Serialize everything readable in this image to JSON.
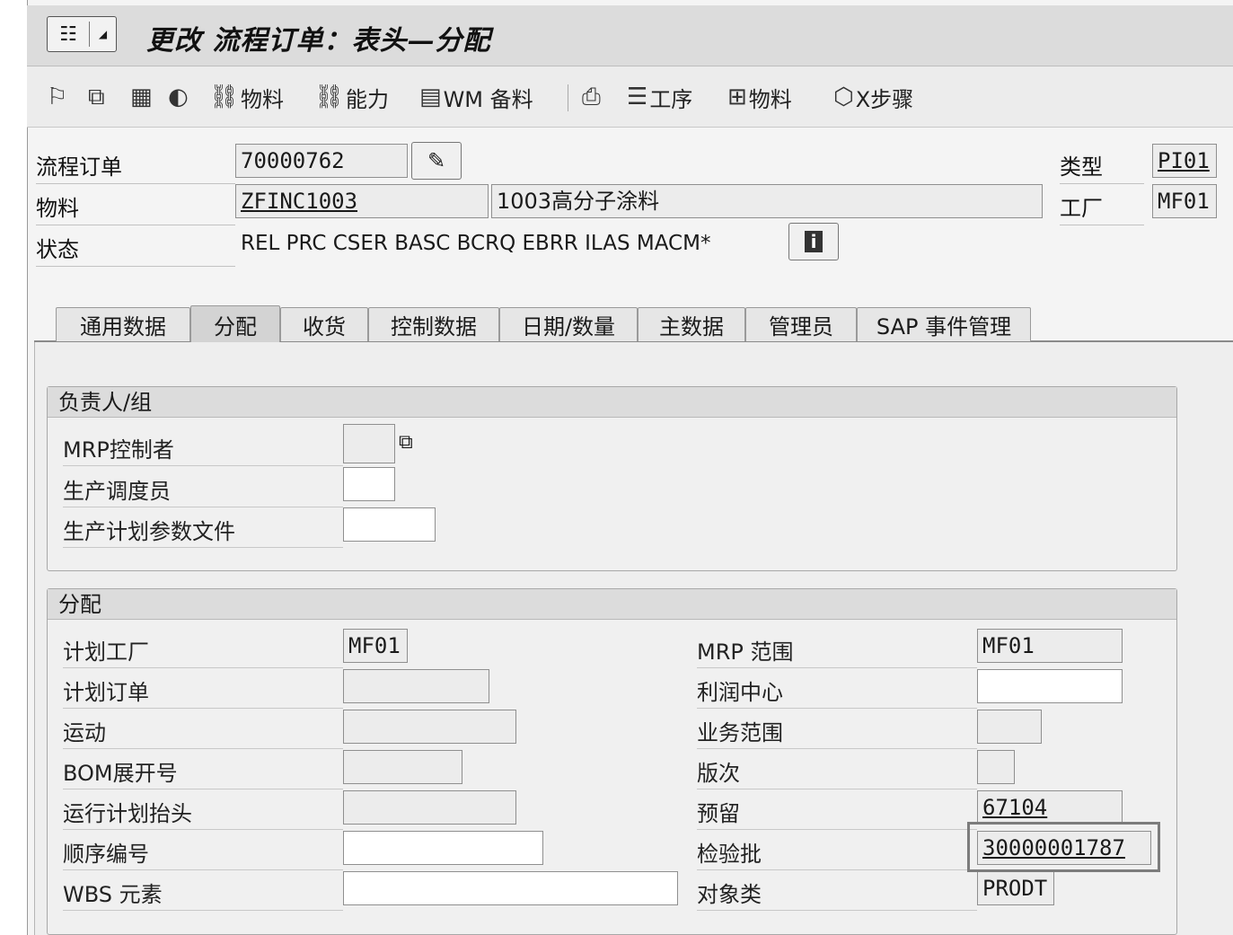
{
  "title": "更改 流程订单：表头—分配",
  "title_menu": {
    "icon": "sap-menu-icon",
    "dropdown": "chevron-down-icon"
  },
  "toolbar": [
    {
      "icon": "flag-icon",
      "label": ""
    },
    {
      "icon": "copy-icon",
      "label": ""
    },
    {
      "icon": "calculator-icon",
      "label": ""
    },
    {
      "icon": "globe-icon",
      "label": ""
    },
    {
      "icon": "hierarchy-icon",
      "label": "物料"
    },
    {
      "icon": "hierarchy-icon",
      "label": "能力"
    },
    {
      "icon": "document-icon",
      "label": "WM 备料"
    },
    {
      "icon": "printer-icon",
      "label": ""
    },
    {
      "icon": "operations-icon",
      "label": "工序"
    },
    {
      "icon": "structure-icon",
      "label": "物料"
    },
    {
      "icon": "cube-icon",
      "label": "X步骤"
    }
  ],
  "header": {
    "order_label": "流程订单",
    "order_value": "70000762",
    "material_label": "物料",
    "material_value": "ZFINC1003",
    "material_desc": "1003高分子涂料",
    "status_label": "状态",
    "status_value": "REL  PRC  CSER BASC BCRQ EBRR ILAS MACM*",
    "type_label": "类型",
    "type_value": "PI01",
    "plant_label": "工厂",
    "plant_value": "MF01"
  },
  "tabs": [
    {
      "label": "通用数据",
      "active": false
    },
    {
      "label": "分配",
      "active": true
    },
    {
      "label": "收货",
      "active": false
    },
    {
      "label": "控制数据",
      "active": false
    },
    {
      "label": "日期/数量",
      "active": false
    },
    {
      "label": "主数据",
      "active": false
    },
    {
      "label": "管理员",
      "active": false
    },
    {
      "label": "SAP 事件管理",
      "active": false
    }
  ],
  "responsible_group": {
    "title": "负责人/组",
    "mrp_controller_label": "MRP控制者",
    "mrp_controller_value": "",
    "scheduler_label": "生产调度员",
    "scheduler_value": "",
    "profile_label": "生产计划参数文件",
    "profile_value": ""
  },
  "assignment_group": {
    "title": "分配",
    "left": [
      {
        "label": "计划工厂",
        "value": "MF01"
      },
      {
        "label": "计划订单",
        "value": ""
      },
      {
        "label": "运动",
        "value": ""
      },
      {
        "label": "BOM展开号",
        "value": ""
      },
      {
        "label": "运行计划抬头",
        "value": ""
      },
      {
        "label": "顺序编号",
        "value": ""
      },
      {
        "label": "WBS 元素",
        "value": ""
      }
    ],
    "right": [
      {
        "label": "MRP 范围",
        "value": "MF01"
      },
      {
        "label": "利润中心",
        "value": ""
      },
      {
        "label": "业务范围",
        "value": ""
      },
      {
        "label": "版次",
        "value": ""
      },
      {
        "label": "预留",
        "value": "67104"
      },
      {
        "label": "检验批",
        "value": "30000001787"
      },
      {
        "label": "对象类",
        "value": "PRODT"
      }
    ]
  },
  "colors": {
    "highlight_border": "#7c7c7c",
    "field_bg": "#ececec",
    "frame_bg": "#f4f4f4"
  }
}
